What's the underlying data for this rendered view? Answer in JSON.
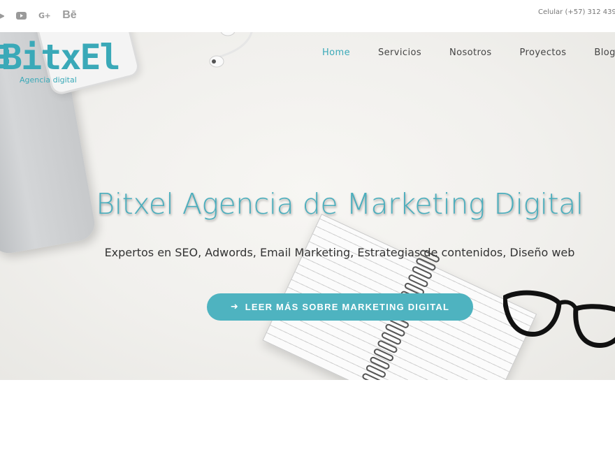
{
  "topbar": {
    "social_icons": [
      "twitter-icon",
      "youtube-icon",
      "google-plus-icon",
      "behance-icon"
    ],
    "google_plus_text": "G+",
    "behance_text": "Bē",
    "contact": "Celular (+57) 312 439"
  },
  "logo": {
    "wordmark": "BitxEl",
    "tagline": "Agencia digital"
  },
  "nav": {
    "items": [
      "Home",
      "Servicios",
      "Nosotros",
      "Proyectos",
      "Blog"
    ],
    "active": "Home"
  },
  "hero": {
    "headline": "Bitxel Agencia de Marketing Digital",
    "subheadline": "Expertos en SEO, Adwords, Email Marketing, Estrategias de contenidos, Diseño web",
    "cta_label": "LEER MÁS SOBRE MARKETING DIGITAL",
    "cta_icon": "arrow-right-icon"
  },
  "colors": {
    "accent": "#4eb3c0",
    "nav_active": "#3aa9b8",
    "text": "#333333"
  }
}
